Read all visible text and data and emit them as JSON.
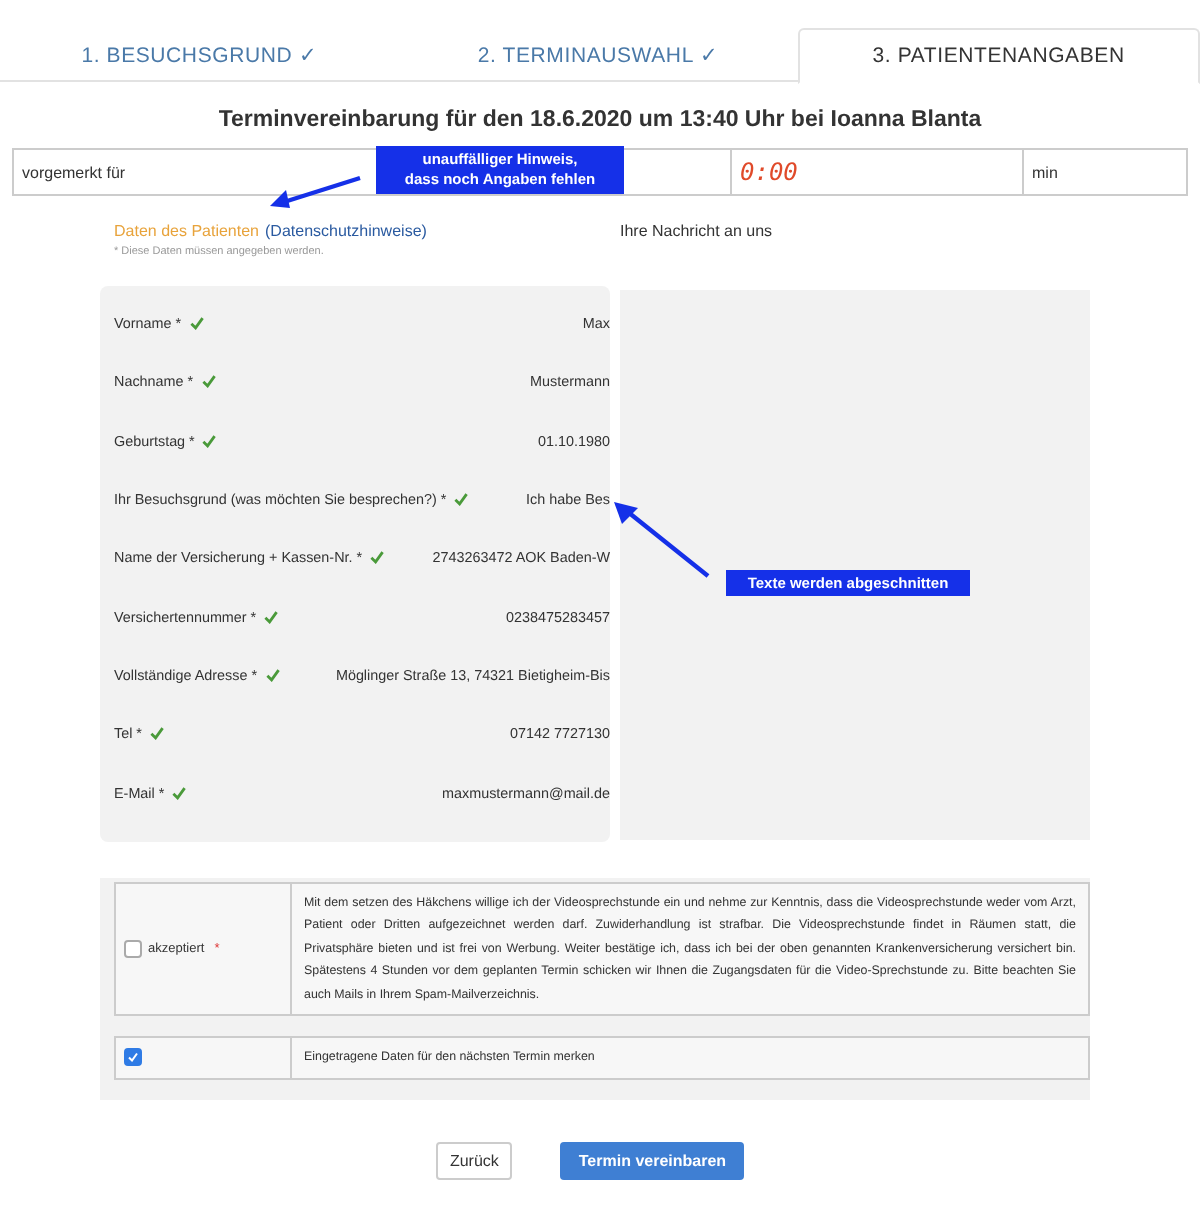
{
  "tabs": [
    {
      "label": "1. BESUCHSGRUND ✓",
      "selected": false
    },
    {
      "label": "2. TERMINAUSWAHL ✓",
      "selected": false
    },
    {
      "label": "3. PATIENTENANGABEN",
      "selected": true
    }
  ],
  "title": "Terminvereinbarung für den 18.6.2020 um 13:40 Uhr bei Ioanna Blanta",
  "reserved": {
    "label": "vorgemerkt für",
    "timer": "0:00",
    "unit": "min"
  },
  "patient": {
    "heading": "Daten des Patienten",
    "link": "(Datenschutzhinweise)",
    "note": "* Diese Daten müssen angegeben werden.",
    "fields": [
      {
        "label": "Vorname *",
        "valid": true,
        "value": "Max"
      },
      {
        "label": "Nachname *",
        "valid": true,
        "value": "Mustermann"
      },
      {
        "label": "Geburtstag *",
        "valid": true,
        "value": "01.10.1980"
      },
      {
        "label": "Ihr Besuchsgrund (was möchten Sie besprechen?) *",
        "valid": true,
        "value": "Ich habe Bes"
      },
      {
        "label": "Name der Versicherung + Kassen-Nr. *",
        "valid": true,
        "value": "2743263472 AOK Baden-W"
      },
      {
        "label": "Versichertennummer *",
        "valid": true,
        "value": "0238475283457"
      },
      {
        "label": "Vollständige Adresse *",
        "valid": true,
        "value": "Möglinger Straße 13, 74321 Bietigheim-Bis"
      },
      {
        "label": "Tel *",
        "valid": true,
        "value": "07142 7727130"
      },
      {
        "label": "E-Mail *",
        "valid": true,
        "value": "maxmustermann@mail.de"
      }
    ]
  },
  "message": {
    "heading": "Ihre Nachricht an uns"
  },
  "consents": [
    {
      "label": "akzeptiert",
      "required": "*",
      "checked": false,
      "text": "Mit dem setzen des Häkchens willige ich der Videosprechstunde ein und nehme zur Kenntnis, dass die Videosprechstunde weder vom Arzt, Patient oder Dritten aufgezeichnet werden darf. Zuwiderhandlung ist strafbar. Die Videosprechstunde findet in Räumen statt, die Privatsphäre bieten und ist frei von Werbung. Weiter bestätige ich, dass ich bei der oben genannten Krankenversicherung versichert bin.   Spätestens 4 Stunden vor dem geplanten Termin schicken wir Ihnen die Zugangsdaten für die Video-Sprechstunde zu. Bitte beachten Sie auch Mails in Ihrem Spam-Mailverzeichnis."
    },
    {
      "checked": true,
      "text": "Eingetragene Daten für den nächsten Termin merken"
    }
  ],
  "buttons": {
    "back": "Zurück",
    "submit": "Termin vereinbaren"
  },
  "annotations": [
    {
      "text": "unauffälliger Hinweis,\ndass noch Angaben fehlen"
    },
    {
      "text": "Texte werden abgeschnitten"
    }
  ]
}
